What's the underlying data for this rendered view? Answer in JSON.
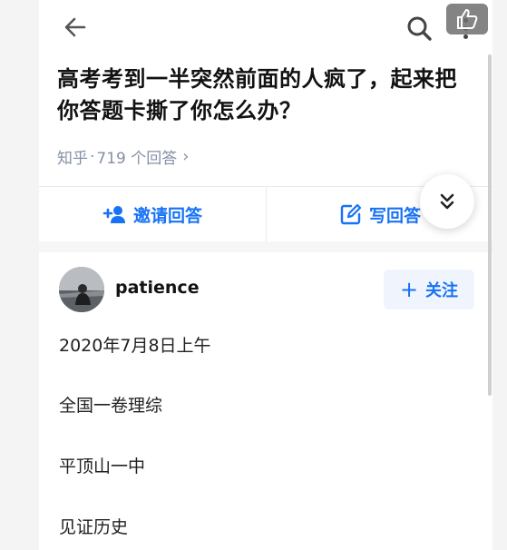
{
  "question": {
    "title": "高考考到一半突然前面的人疯了，起来把你答题卡撕了你怎么办？",
    "source": "知乎",
    "separator": " · ",
    "answer_count": "719 个回答",
    "chevron": "›"
  },
  "actions": {
    "invite_label": "邀请回答",
    "write_label": "写回答"
  },
  "answer": {
    "author": "patience",
    "follow_plus": "+",
    "follow_label": "关注",
    "lines": [
      "2020年7月8日上午",
      "全国一卷理综",
      "平顶山一中",
      "见证历史"
    ]
  },
  "colors": {
    "accent": "#1772f6",
    "title": "#121212",
    "meta": "#8590a6"
  },
  "icons": [
    "back-arrow-icon",
    "search-icon",
    "more-icon",
    "add-person-icon",
    "edit-icon",
    "double-chevron-down-icon",
    "thumbs-up-icon"
  ]
}
